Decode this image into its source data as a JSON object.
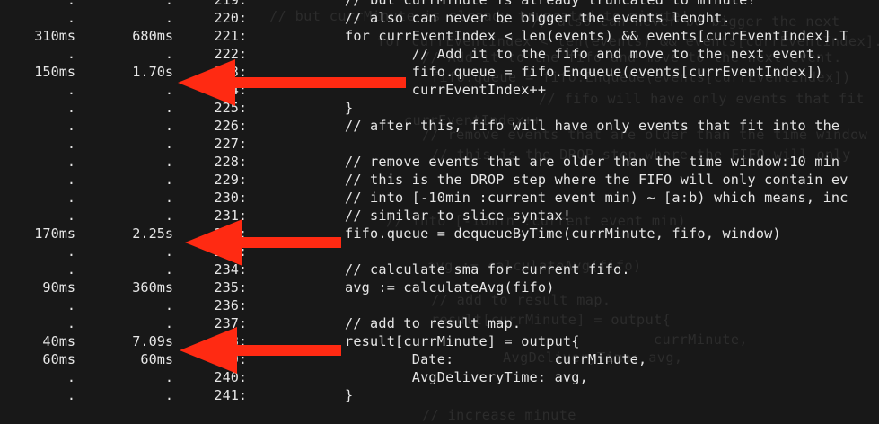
{
  "accent_color": "#ff2a12",
  "ghost_lines": [
    "// but currMinute is already truncated to minute!",
    "// also can never be bigger the next",
    "for currEventIndex < len(events) && events[currEventIndex].T",
    "// Add it to the fifo and move to the next event.",
    "fifo.queue = fifo.Enqueue(events[currEventIndex])",
    "// fifo will have only events that fit",
    "currEventIndex++",
    "// remove events that are older than the time window",
    "// this is the DROP step where the FIFO will only",
    "// into [-10min :current event min)",
    "avg := calculateAvg(fifo)",
    "// add to result map.",
    "result[currMinute] = output{",
    "currMinute,",
    "AvgDeliveryTime: avg,",
    "// increase minute"
  ],
  "rows": [
    {
      "t1": ".",
      "t2": ".",
      "ln": "219:",
      "code": "// but currMinute is already truncated to minute!"
    },
    {
      "t1": ".",
      "t2": ".",
      "ln": "220:",
      "code": "// also can never be bigger the events lenght."
    },
    {
      "t1": "310ms",
      "t2": "680ms",
      "ln": "221:",
      "code": "for currEventIndex < len(events) && events[currEventIndex].T"
    },
    {
      "t1": ".",
      "t2": ".",
      "ln": "222:",
      "code": "        // Add it to the fifo and move to the next event."
    },
    {
      "t1": "150ms",
      "t2": "1.70s",
      "ln": "223:",
      "code": "        fifo.queue = fifo.Enqueue(events[currEventIndex])"
    },
    {
      "t1": ".",
      "t2": ".",
      "ln": "224:",
      "code": "        currEventIndex++"
    },
    {
      "t1": ".",
      "t2": ".",
      "ln": "225:",
      "code": "}"
    },
    {
      "t1": ".",
      "t2": ".",
      "ln": "226:",
      "code": "// after this, fifo will have only events that fit into the"
    },
    {
      "t1": ".",
      "t2": ".",
      "ln": "227:",
      "code": ""
    },
    {
      "t1": ".",
      "t2": ".",
      "ln": "228:",
      "code": "// remove events that are older than the time window:10 min"
    },
    {
      "t1": ".",
      "t2": ".",
      "ln": "229:",
      "code": "// this is the DROP step where the FIFO will only contain ev"
    },
    {
      "t1": ".",
      "t2": ".",
      "ln": "230:",
      "code": "// into [-10min :current event min) ~ [a:b) which means, inc"
    },
    {
      "t1": ".",
      "t2": ".",
      "ln": "231:",
      "code": "// similar to slice syntax!"
    },
    {
      "t1": "170ms",
      "t2": "2.25s",
      "ln": "232:",
      "code": "fifo.queue = dequeueByTime(currMinute, fifo, window)"
    },
    {
      "t1": ".",
      "t2": ".",
      "ln": "233:",
      "code": ""
    },
    {
      "t1": ".",
      "t2": ".",
      "ln": "234:",
      "code": "// calculate sma for current fifo."
    },
    {
      "t1": "90ms",
      "t2": "360ms",
      "ln": "235:",
      "code": "avg := calculateAvg(fifo)"
    },
    {
      "t1": ".",
      "t2": ".",
      "ln": "236:",
      "code": ""
    },
    {
      "t1": ".",
      "t2": ".",
      "ln": "237:",
      "code": "// add to result map."
    },
    {
      "t1": "40ms",
      "t2": "7.09s",
      "ln": "238:",
      "code": "result[currMinute] = output{"
    },
    {
      "t1": "60ms",
      "t2": "60ms",
      "ln": "239:",
      "code": "        Date:            currMinute,"
    },
    {
      "t1": ".",
      "t2": ".",
      "ln": "240:",
      "code": "        AvgDeliveryTime: avg,"
    },
    {
      "t1": ".",
      "t2": ".",
      "ln": "241:",
      "code": "}"
    }
  ]
}
